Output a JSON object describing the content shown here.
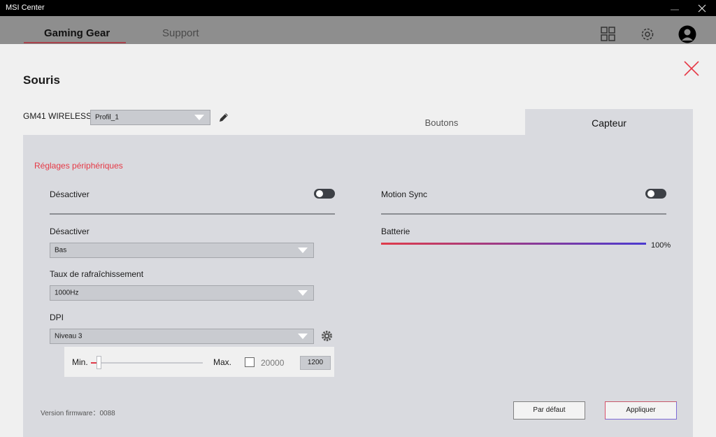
{
  "window": {
    "title": "MSI Center"
  },
  "nav": {
    "tabs": [
      "Gaming Gear",
      "Support"
    ]
  },
  "dialog": {
    "title": "Souris",
    "device_name": "GM41 WIRELESS",
    "profile": "Profil_1",
    "tabs": [
      "Boutons",
      "Capteur"
    ],
    "active_tab": "Capteur",
    "section_title": "Réglages périphériques",
    "left": {
      "toggle1_label": "Désactiver",
      "toggle1_on": false,
      "lod_label": "Désactiver",
      "lod_value": "Bas",
      "polling_label": "Taux de rafraîchissement",
      "polling_value": "1000Hz",
      "dpi_label": "DPI",
      "dpi_value": "Niveau 3",
      "slider_min_label": "Min.",
      "slider_max_label": "Max.",
      "max_checkbox_label": "20000",
      "max_checkbox_checked": false,
      "dpi_number": "1200"
    },
    "right": {
      "motion_sync_label": "Motion Sync",
      "motion_sync_on": false,
      "battery_label": "Batterie",
      "battery_value": "100%"
    },
    "firmware": "Version firmware：0088",
    "buttons": {
      "default": "Par défaut",
      "apply": "Appliquer"
    }
  },
  "colors": {
    "accent": "#e63946",
    "panel": "#d9dadf",
    "toggle_off": "#3d4046"
  },
  "icons": [
    "minimize-icon",
    "close-icon",
    "grid-icon",
    "gear-icon",
    "avatar-icon",
    "pencil-icon"
  ]
}
